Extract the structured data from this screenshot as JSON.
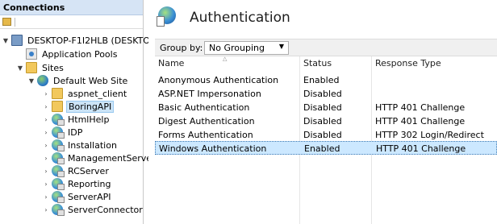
{
  "connections": {
    "title": "Connections",
    "toolbar": {
      "icon": "folder-icon"
    },
    "tree": [
      {
        "label": "DESKTOP-F1I2HLB (DESKTOP-",
        "icon": "server-icon",
        "expander": "down"
      },
      {
        "label": "Application Pools",
        "icon": "app-pool-icon",
        "expander": ""
      },
      {
        "label": "Sites",
        "icon": "folder-icon",
        "expander": "down"
      },
      {
        "label": "Default Web Site",
        "icon": "globe-icon",
        "expander": "down"
      },
      {
        "label": "aspnet_client",
        "icon": "folder-icon",
        "expander": "right"
      },
      {
        "label": "BoringAPI",
        "icon": "folder-icon",
        "expander": "right",
        "selected": true
      },
      {
        "label": "HtmlHelp",
        "icon": "web-app-icon",
        "expander": "right"
      },
      {
        "label": "IDP",
        "icon": "web-app-icon",
        "expander": "right"
      },
      {
        "label": "Installation",
        "icon": "web-app-icon",
        "expander": "right"
      },
      {
        "label": "ManagementServe",
        "icon": "web-app-icon",
        "expander": "right"
      },
      {
        "label": "RCServer",
        "icon": "web-app-icon",
        "expander": "right"
      },
      {
        "label": "Reporting",
        "icon": "web-app-icon",
        "expander": "right"
      },
      {
        "label": "ServerAPI",
        "icon": "web-app-icon",
        "expander": "right"
      },
      {
        "label": "ServerConnector",
        "icon": "web-app-icon",
        "expander": "right"
      }
    ]
  },
  "feature": {
    "title": "Authentication",
    "icon": "authentication-icon",
    "group_by_label": "Group by:",
    "group_by_value": "No Grouping",
    "columns": {
      "name": "Name",
      "status": "Status",
      "response_type": "Response Type"
    },
    "rows": [
      {
        "name": "Anonymous Authentication",
        "status": "Enabled",
        "response_type": ""
      },
      {
        "name": "ASP.NET Impersonation",
        "status": "Disabled",
        "response_type": ""
      },
      {
        "name": "Basic Authentication",
        "status": "Disabled",
        "response_type": "HTTP 401 Challenge"
      },
      {
        "name": "Digest Authentication",
        "status": "Disabled",
        "response_type": "HTTP 401 Challenge"
      },
      {
        "name": "Forms Authentication",
        "status": "Disabled",
        "response_type": "HTTP 302 Login/Redirect"
      },
      {
        "name": "Windows Authentication",
        "status": "Enabled",
        "response_type": "HTTP 401 Challenge",
        "selected": true
      }
    ]
  },
  "colors": {
    "header_bg": "#d6e4f5",
    "selection_bg": "#cce8ff",
    "tree_selection_bg": "#cce4f7"
  }
}
